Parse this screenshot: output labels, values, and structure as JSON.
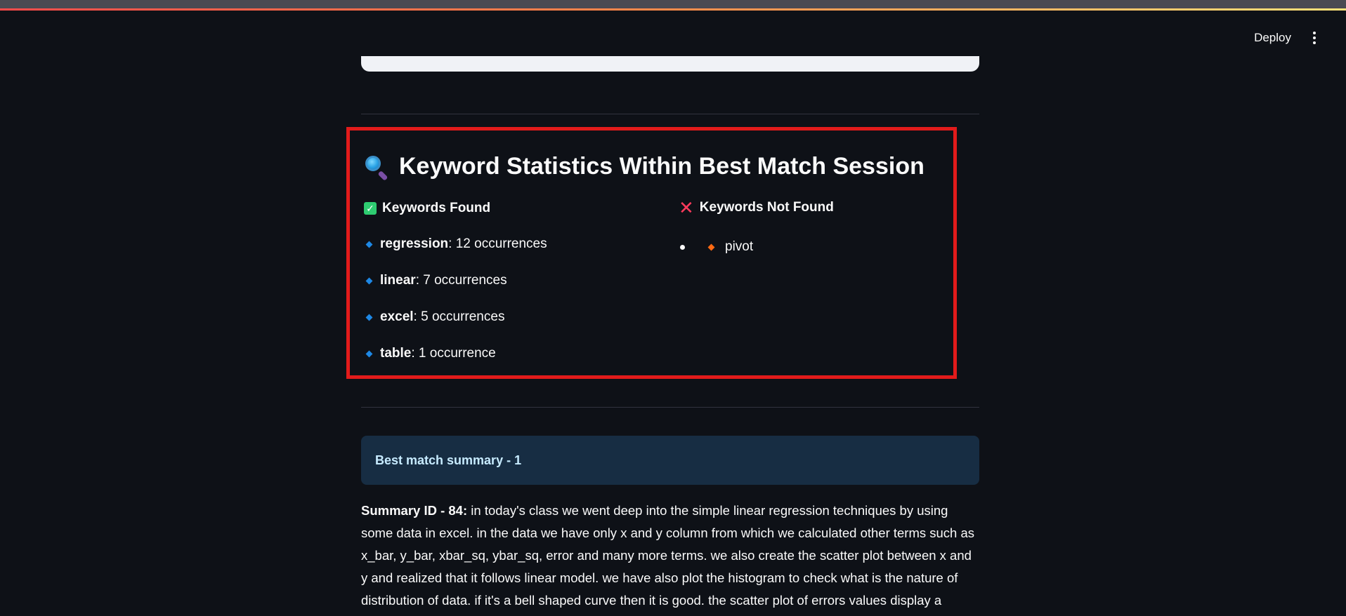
{
  "header": {
    "deploy_label": "Deploy",
    "menu_icon": "kebab-menu-icon"
  },
  "keyword_stats": {
    "title": "Keyword Statistics Within Best Match Session",
    "title_icon": "magnifying-glass-icon",
    "found": {
      "heading": "Keywords Found",
      "icon": "check-icon",
      "items": [
        {
          "keyword": "regression",
          "count_text": ": 12 occurrences"
        },
        {
          "keyword": "linear",
          "count_text": ": 7 occurrences"
        },
        {
          "keyword": "excel",
          "count_text": ": 5 occurrences"
        },
        {
          "keyword": "table",
          "count_text": ": 1 occurrence"
        }
      ]
    },
    "not_found": {
      "heading": "Keywords Not Found",
      "icon": "cross-icon",
      "items": [
        {
          "keyword": "pivot"
        }
      ]
    }
  },
  "summary": {
    "box_label": "Best match summary - 1",
    "id_label": "Summary ID - 84:",
    "text": " in today's class we went deep into the simple linear regression techniques by using some data in excel. in the data we have only x and y column from which we calculated other terms such as x_bar, y_bar, xbar_sq, ybar_sq, error and many more terms. we also create the scatter plot between x and y and realized that it follows linear model. we have also plot the histogram to check what is the nature of distribution of data. if it's a bell shaped curve then it is good. the scatter plot of errors values display a"
  },
  "colors": {
    "background": "#0e1117",
    "highlight_border": "#e21b1b",
    "summary_box": "#172d43",
    "found_bullet": "#1e88e5",
    "not_found_bullet": "#ff6a13"
  }
}
